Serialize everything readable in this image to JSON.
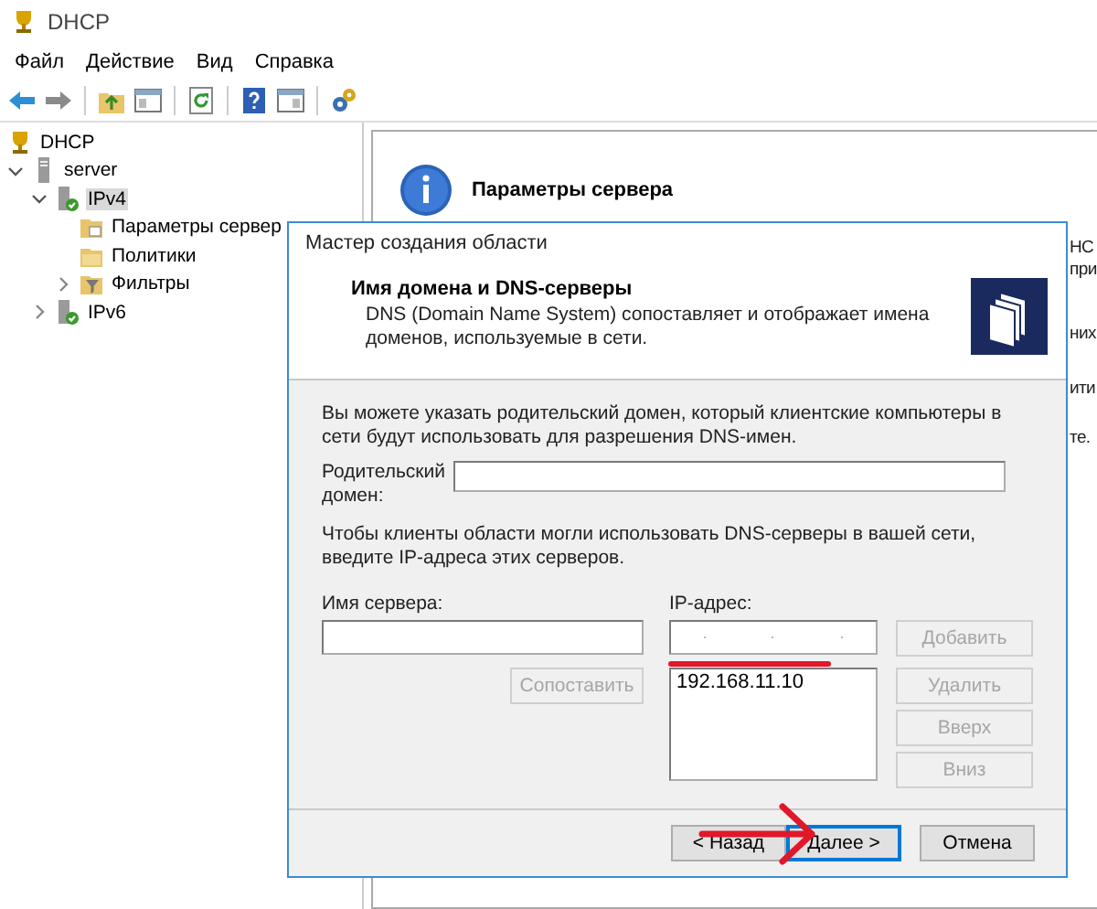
{
  "window": {
    "title": "DHCP"
  },
  "menu": [
    "Файл",
    "Действие",
    "Вид",
    "Справка"
  ],
  "tree": [
    {
      "label": "DHCP",
      "kind": "cup",
      "selected": false,
      "children": [
        {
          "label": "server",
          "kind": "server",
          "expanded": true,
          "selected": false,
          "children": [
            {
              "label": "IPv4",
              "kind": "ip",
              "expanded": true,
              "selected": true,
              "children": [
                {
                  "label": "Параметры сервер",
                  "kind": "options",
                  "selected": false
                },
                {
                  "label": "Политики",
                  "kind": "folder",
                  "selected": false
                },
                {
                  "label": "Фильтры",
                  "kind": "filter",
                  "expanded": false,
                  "selected": false
                }
              ]
            },
            {
              "label": "IPv6",
              "kind": "ip",
              "expanded": false,
              "selected": false
            }
          ]
        }
      ]
    }
  ],
  "details": {
    "title": "Параметры сервера",
    "fragments": [
      "HC",
      "при",
      "них",
      "ити",
      "те."
    ]
  },
  "wizard": {
    "title": "Мастер создания области",
    "heading": "Имя домена и DNS-серверы",
    "description": "DNS (Domain Name System) сопоставляет и отображает имена доменов, используемые в сети.",
    "intro": "Вы можете указать родительский домен, который клиентские компьютеры в сети будут использовать для разрешения DNS-имен.",
    "parent_domain": {
      "label": "Родительский домен:"
    },
    "dns_intro": "Чтобы клиенты области могли использовать DNS-серверы в вашей сети, введите IP-адреса этих серверов.",
    "server_name": {
      "label": "Имя сервера:"
    },
    "ip_address": {
      "label": "IP-адрес:"
    },
    "resolve_button": {
      "label": "Сопоставить",
      "disabled": true
    },
    "ip_list": [
      "192.168.11.10"
    ],
    "side_buttons": [
      {
        "label": "Добавить",
        "disabled": true
      },
      {
        "label": "Удалить",
        "disabled": true
      },
      {
        "label": "Вверх",
        "disabled": true
      },
      {
        "label": "Вниз",
        "disabled": true
      }
    ],
    "footer_buttons": [
      {
        "label": "< Назад",
        "default": false
      },
      {
        "label": "Далее >",
        "default": true
      },
      {
        "label": "Отмена",
        "default": false
      }
    ]
  },
  "annotations": [
    {
      "kind": "underline"
    },
    {
      "kind": "arrow"
    }
  ]
}
